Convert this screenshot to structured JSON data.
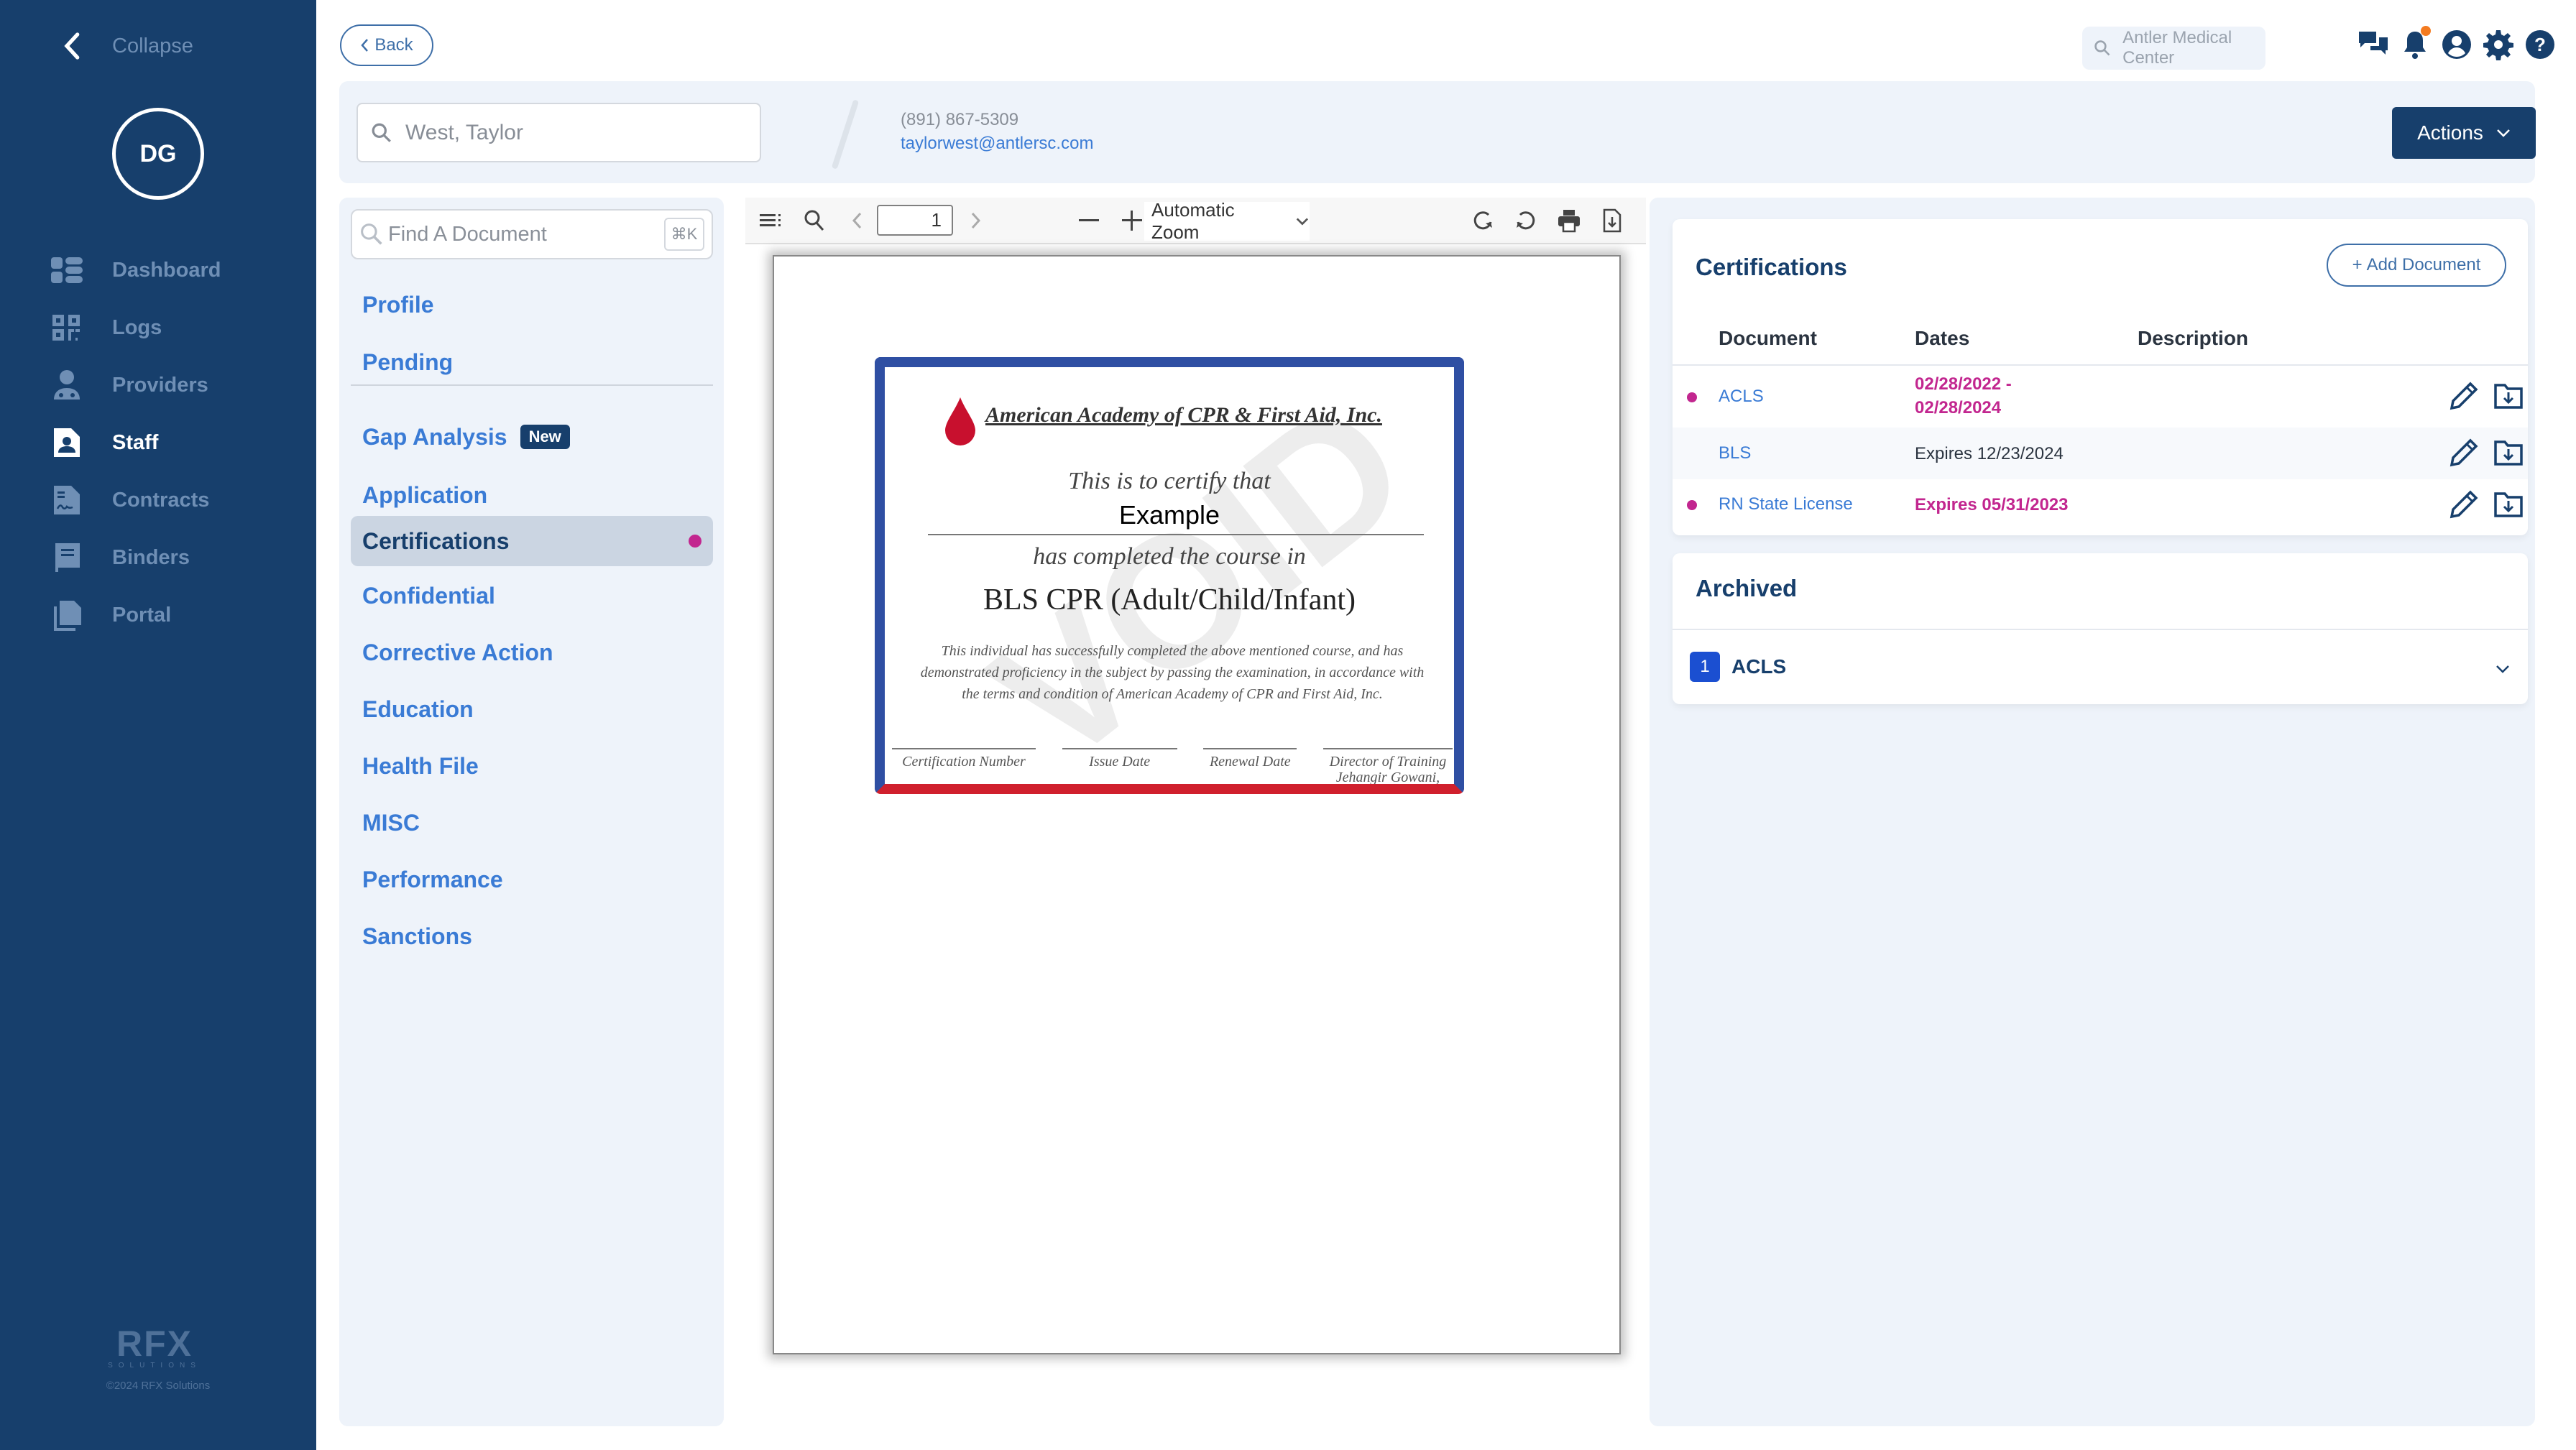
{
  "sidebar": {
    "collapse_label": "Collapse",
    "avatar_initials": "DG",
    "items": [
      {
        "label": "Dashboard",
        "icon": "dashboard-icon",
        "active": false
      },
      {
        "label": "Logs",
        "icon": "qr-code-icon",
        "active": false
      },
      {
        "label": "Providers",
        "icon": "doctor-icon",
        "active": false
      },
      {
        "label": "Staff",
        "icon": "staff-file-icon",
        "active": true
      },
      {
        "label": "Contracts",
        "icon": "contract-icon",
        "active": false
      },
      {
        "label": "Binders",
        "icon": "book-icon",
        "active": false
      },
      {
        "label": "Portal",
        "icon": "copy-files-icon",
        "active": false
      }
    ],
    "logo_text": "RFX",
    "logo_sub": "SOLUTIONS",
    "copyright": "©2024 RFX Solutions"
  },
  "topbar": {
    "back_label": "Back",
    "org_search_placeholder": "Antler Medical Center",
    "icons": [
      "chat-icon",
      "bell-icon",
      "user-circle-icon",
      "gear-icon",
      "help-icon"
    ],
    "notification_dot_color": "#f47b20"
  },
  "header": {
    "staff_search_value": "West, Taylor",
    "phone": "(891) 867-5309",
    "email": "taylorwest@antlersc.com",
    "actions_label": "Actions"
  },
  "docnav": {
    "find_placeholder": "Find A Document",
    "shortcut": "⌘K",
    "top_items": [
      "Profile",
      "Pending"
    ],
    "items": [
      {
        "label": "Gap Analysis",
        "badge": "New"
      },
      {
        "label": "Application"
      },
      {
        "label": "Certifications",
        "active": true,
        "alert": true
      },
      {
        "label": "Confidential"
      },
      {
        "label": "Corrective Action"
      },
      {
        "label": "Education"
      },
      {
        "label": "Health File"
      },
      {
        "label": "MISC"
      },
      {
        "label": "Performance"
      },
      {
        "label": "Sanctions"
      }
    ]
  },
  "pdf": {
    "page_number": "1",
    "zoom_label": "Automatic Zoom",
    "certificate": {
      "watermark": "VOID",
      "org": "American Academy of CPR & First Aid, Inc.",
      "line1": "This is to certify that",
      "name": "Example",
      "line2": "has completed the course in",
      "course": "BLS CPR (Adult/Child/Infant)",
      "body": "This individual has successfully completed the above mentioned course, and has demonstrated proficiency in the subject by passing the examination, in accordance with the terms and condition of  American Academy of  CPR and First Aid, Inc.",
      "sig1": "Certification Number",
      "sig2": "Issue Date",
      "sig3": "Renewal Date",
      "sig4a": "Director of  Training",
      "sig4b": "Jehangir Gowani, MD"
    }
  },
  "certifications": {
    "title": "Certifications",
    "add_label": "Add Document",
    "columns": [
      "Document",
      "Dates",
      "Description"
    ],
    "rows": [
      {
        "document": "ACLS",
        "dates_line1": "02/28/2022 -",
        "dates_line2": "02/28/2024",
        "description": "",
        "alert": true
      },
      {
        "document": "BLS",
        "dates_line1": "Expires 12/23/2024",
        "dates_line2": "",
        "description": "",
        "alert": false
      },
      {
        "document": "RN State License",
        "dates_line1": "Expires 05/31/2023",
        "dates_line2": "",
        "description": "",
        "alert": true
      }
    ]
  },
  "archived": {
    "title": "Archived",
    "items": [
      {
        "count": "1",
        "label": "ACLS"
      }
    ]
  },
  "colors": {
    "sidebar_bg": "#173f6c",
    "accent_link": "#3a7bd5",
    "alert": "#c2268f",
    "panel_bg": "#eef3fa"
  }
}
